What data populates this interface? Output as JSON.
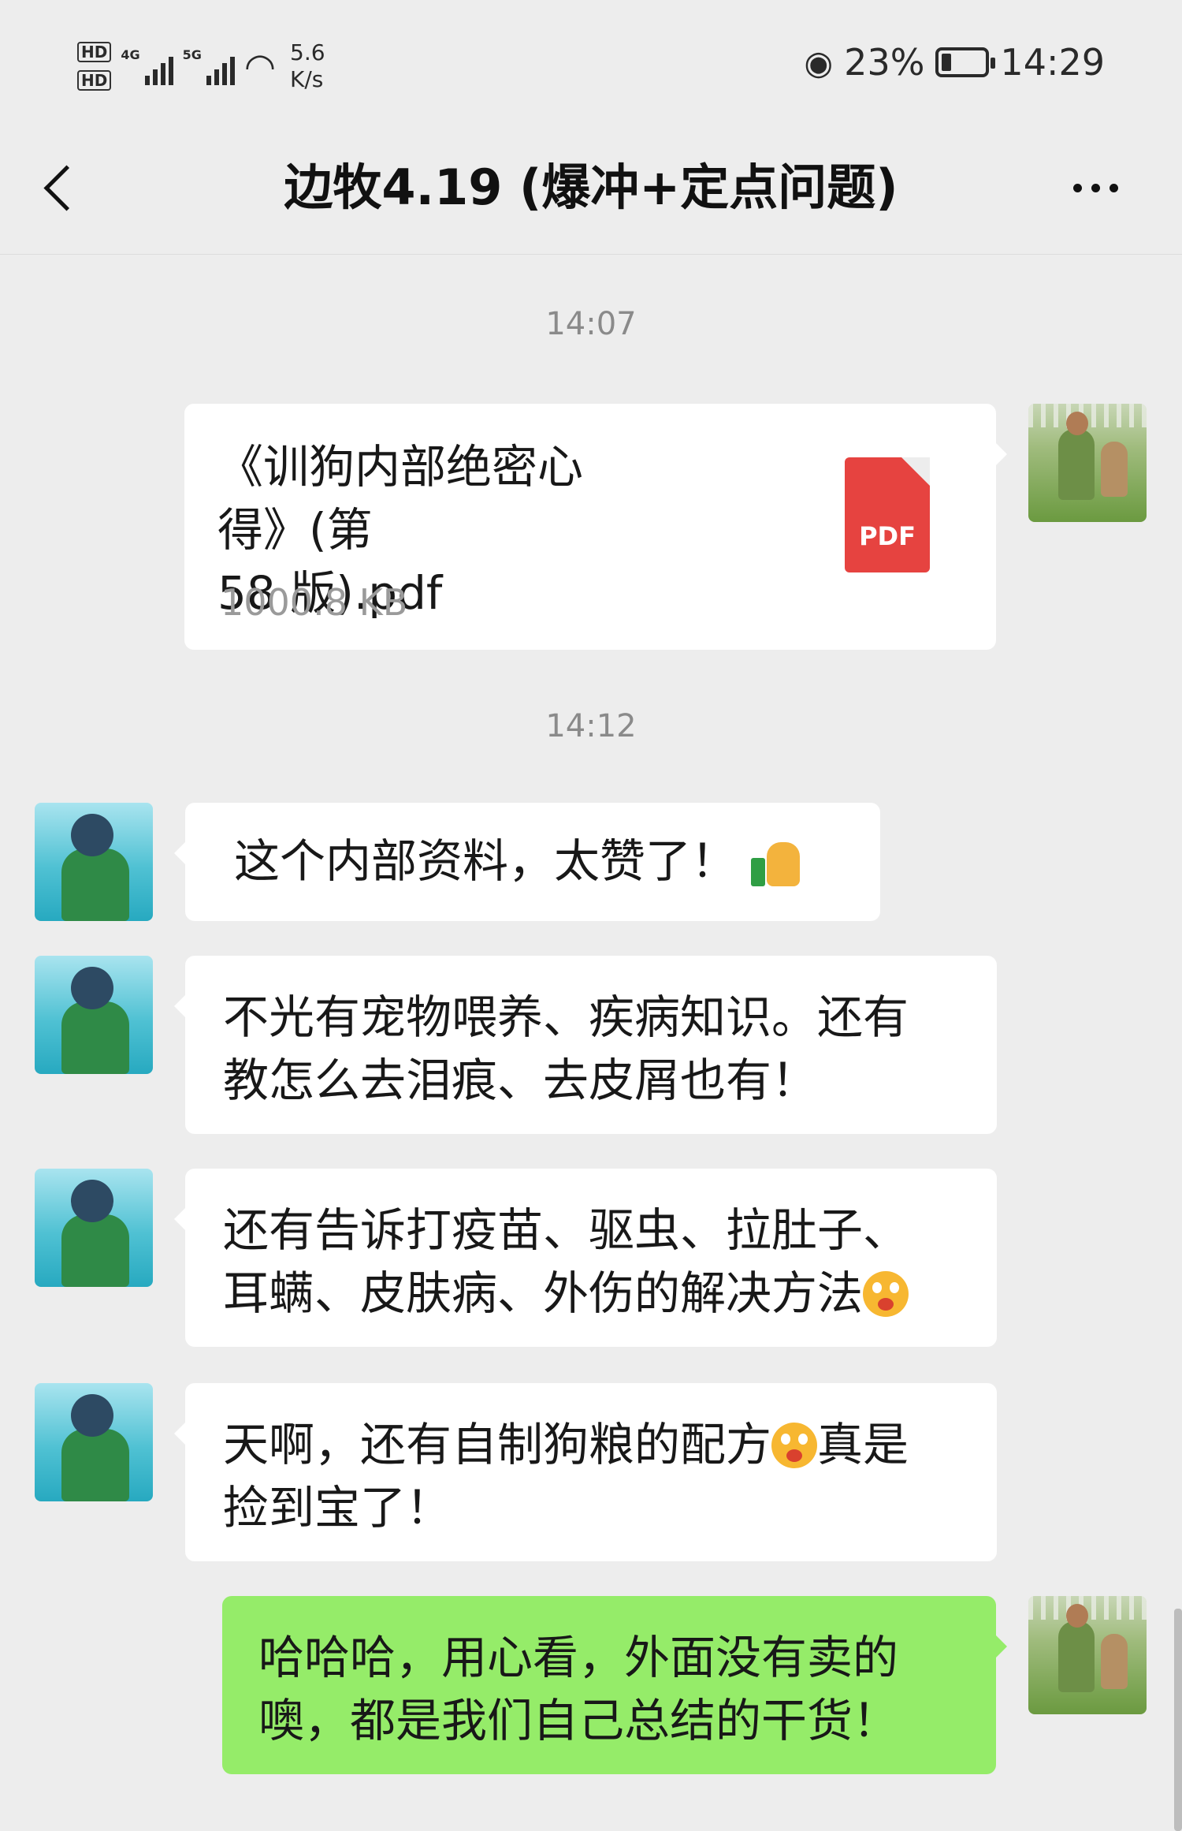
{
  "status_bar": {
    "hd1": "HD",
    "hd2": "HD",
    "sim1_net": "4G",
    "sim2_net": "5G",
    "speed_value": "5.6",
    "speed_unit": "K/s",
    "battery_percent": "23%",
    "battery_level": 0.23,
    "clock": "14:29"
  },
  "nav": {
    "title": "边牧4.19 (爆冲+定点问题)"
  },
  "messages": {
    "time1": "14:07",
    "file": {
      "name": "《训狗内部绝密心得》(第\n58 版).pdf",
      "size": "1000.8 KB",
      "icon_label": "PDF"
    },
    "time2": "14:12",
    "msg1": "这个内部资料，太赞了！",
    "msg2": "不光有宠物喂养、疾病知识。还有\n教怎么去泪痕、去皮屑也有！",
    "msg3a": "还有告诉打疫苗、驱虫、拉肚子、\n耳螨、皮肤病、外伤的解决方法",
    "msg4a": "天啊，还有自制狗粮的配方",
    "msg4b": "真是",
    "msg4c": "捡到宝了！",
    "msg5": "哈哈哈，用心看，外面没有卖的\n噢，都是我们自己总结的干货！"
  },
  "colors": {
    "background": "#ededed",
    "bubble_white": "#ffffff",
    "bubble_green": "#95ec69",
    "pdf_red": "#e64340"
  }
}
